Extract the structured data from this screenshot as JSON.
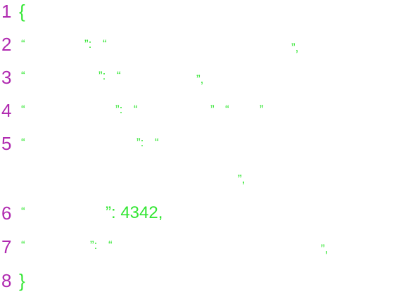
{
  "colors": {
    "line_number": "#b02ab0",
    "token": "#33e633",
    "background": "#ffffff"
  },
  "editor": {
    "lines": [
      {
        "number": "1",
        "tokens": [
          "{"
        ]
      },
      {
        "number": "2",
        "tokens": [
          "“",
          "”:",
          "“",
          "”,"
        ]
      },
      {
        "number": "3",
        "tokens": [
          "“",
          "”:",
          "“",
          "”,"
        ]
      },
      {
        "number": "4",
        "tokens": [
          "“",
          "”:",
          "“",
          "”",
          "“",
          "”"
        ]
      },
      {
        "number": "5",
        "tokens": [
          "“",
          "”:",
          "“",
          "”,"
        ]
      },
      {
        "number": "6",
        "tokens": [
          "“",
          "”: 4342,"
        ]
      },
      {
        "number": "7",
        "tokens": [
          "“",
          "”:",
          "“",
          "”,"
        ]
      },
      {
        "number": "8",
        "tokens": [
          "}"
        ]
      }
    ]
  }
}
